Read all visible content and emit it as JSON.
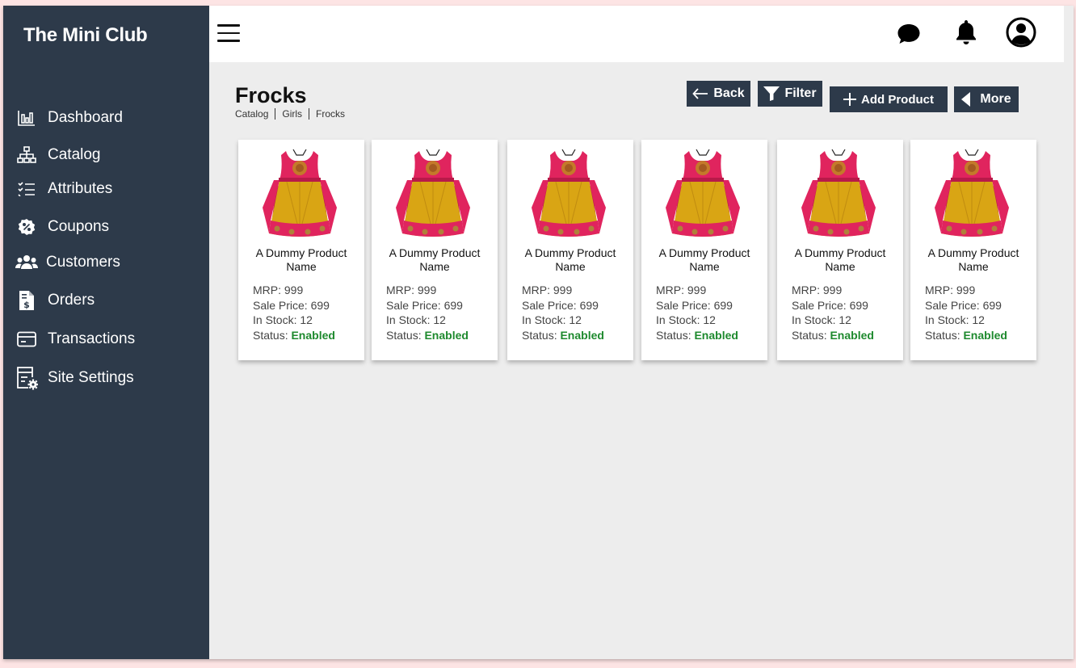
{
  "brand": "The Mini Club",
  "sidebar": {
    "items": [
      {
        "label": "Dashboard",
        "icon": "bar-chart-icon"
      },
      {
        "label": "Catalog",
        "icon": "sitemap-icon"
      },
      {
        "label": "Attributes",
        "icon": "list-check-icon"
      },
      {
        "label": "Coupons",
        "icon": "coupon-badge-icon"
      },
      {
        "label": "Customers",
        "icon": "users-icon"
      },
      {
        "label": "Orders",
        "icon": "invoice-icon"
      },
      {
        "label": "Transactions",
        "icon": "credit-card-icon"
      },
      {
        "label": "Site Settings",
        "icon": "settings-form-icon"
      }
    ]
  },
  "topbar": {
    "icons": [
      "menu-icon",
      "chat-icon",
      "bell-icon",
      "user-circle-icon"
    ]
  },
  "page": {
    "title": "Frocks",
    "breadcrumb": [
      "Catalog",
      "Girls",
      "Frocks"
    ]
  },
  "toolbar": {
    "back_label": "Back",
    "filter_label": "Filter",
    "add_label": "Add Product",
    "more_label": "More"
  },
  "labels": {
    "mrp": "MRP: ",
    "sale": "Sale Price: ",
    "stock": "In Stock: ",
    "status": "Status: "
  },
  "products": [
    {
      "name": "A Dummy Product Name",
      "mrp": "999",
      "sale_price": "699",
      "stock": "12",
      "status": "Enabled"
    },
    {
      "name": "A Dummy Product Name",
      "mrp": "999",
      "sale_price": "699",
      "stock": "12",
      "status": "Enabled"
    },
    {
      "name": "A Dummy Product Name",
      "mrp": "999",
      "sale_price": "699",
      "stock": "12",
      "status": "Enabled"
    },
    {
      "name": "A Dummy Product Name",
      "mrp": "999",
      "sale_price": "699",
      "stock": "12",
      "status": "Enabled"
    },
    {
      "name": "A Dummy Product Name",
      "mrp": "999",
      "sale_price": "699",
      "stock": "12",
      "status": "Enabled"
    },
    {
      "name": "A Dummy Product Name",
      "mrp": "999",
      "sale_price": "699",
      "stock": "12",
      "status": "Enabled"
    }
  ],
  "colors": {
    "sidebar": "#2d3a4a",
    "status_enabled": "#1e8a2e",
    "page_bg": "#ededed",
    "frock_pink": "#e0245e",
    "frock_gold": "#d9a514"
  }
}
